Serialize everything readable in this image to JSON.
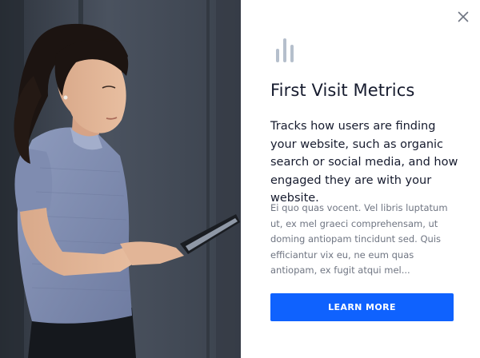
{
  "modal": {
    "close_label": "Close",
    "title": "First Visit Metrics",
    "lead": "Tracks how users are finding your website, such as organic search or social media, and how engaged they are with your website.",
    "body": "Ei quo quas vocent. Vel libris luptatum ut, ex mel graeci comprehensam, ut doming antiopam tincidunt sed. Quis efficiantur vix eu, ne eum quas antiopam, ex fugit atqui mel...",
    "cta_label": "LEARN MORE"
  },
  "icons": {
    "close": "close-icon",
    "header": "bar-chart-icon"
  },
  "colors": {
    "accent": "#0f62fe",
    "title_text": "#161b2e",
    "body_text": "#6f7582",
    "icon_muted": "#b5bfcc"
  }
}
